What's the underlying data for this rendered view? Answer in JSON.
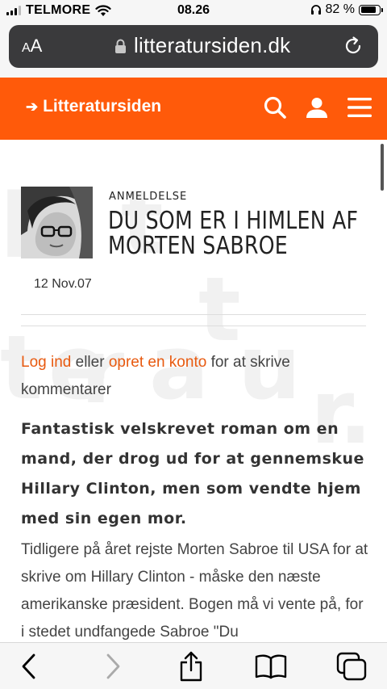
{
  "status_bar": {
    "carrier": "TELMORE",
    "time": "08.26",
    "battery_percent": "82 %",
    "battery_level": 0.82
  },
  "browser": {
    "text_size_label_small": "A",
    "text_size_label_large": "A",
    "url": "litteratursiden.dk"
  },
  "site": {
    "logo_text": "Litteratursiden",
    "brand_color": "#ff5a0a",
    "link_color": "#e85a10"
  },
  "article": {
    "category": "ANMELDELSE",
    "title_line1": "DU SOM ER I HIMLEN AF",
    "title_line2": "MORTEN SABROE",
    "date": "12 Nov.07"
  },
  "comments": {
    "login_link": "Log ind",
    "or_text": " eller ",
    "register_link": "opret en konto",
    "suffix": " for at skrive kommentarer"
  },
  "content": {
    "lead": "Fantastisk velskrevet roman om en mand, der drog ud for at gennemskue Hillary Clinton, men som vendte hjem med sin egen mor.",
    "paragraph": "Tidligere på året rejste Morten Sabroe til USA for at skrive om Hillary Clinton - måske den næste amerikanske præsident. Bogen må vi vente på, for i stedet undfangede Sabroe \"Du"
  },
  "watermark_letters": [
    "li",
    "t",
    "t",
    "t",
    "e",
    "r",
    "a",
    "u",
    "r",
    "."
  ]
}
